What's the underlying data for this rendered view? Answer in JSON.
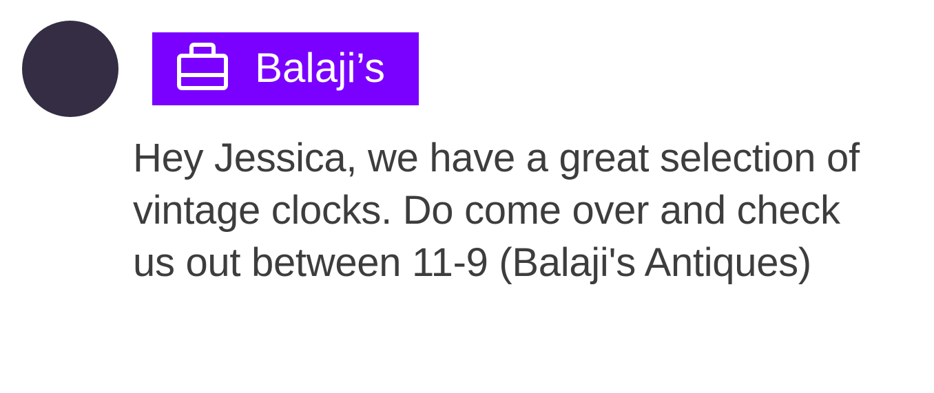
{
  "sender": {
    "avatar_color": "#342d43",
    "badge": {
      "icon": "business-briefcase-icon",
      "label": "Balaji’s",
      "background": "#7a00ff"
    }
  },
  "message": {
    "lines": [
      "Hey Jessica, we have a great selection of",
      "vintage clocks. Do come over and check",
      "us out between 11-9 (Balaji's Antiques)"
    ]
  }
}
